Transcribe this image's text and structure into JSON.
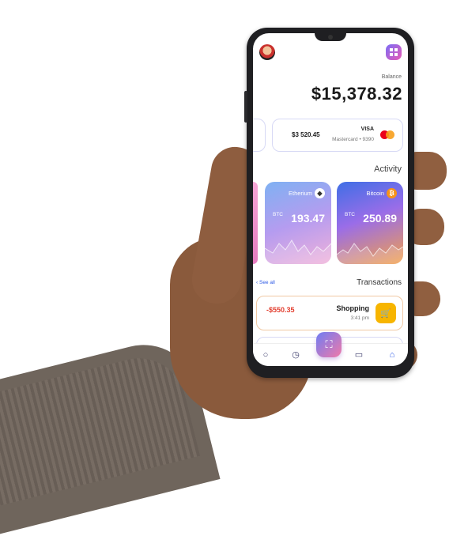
{
  "balance": {
    "label": "Balance",
    "value": "$15,378.32"
  },
  "card": {
    "brand": "VISA",
    "subtitle": "Mastercard • 9390",
    "amount": "$3 520.45",
    "icon": "mastercard-icon"
  },
  "activity": {
    "title": "Activity",
    "tiles": [
      {
        "name": "Bitcoin",
        "value": "250.89",
        "unit": "BTC",
        "icon": "bitcoin-icon"
      },
      {
        "name": "Etherium",
        "value": "193.47",
        "unit": "BTC",
        "icon": "ethereum-icon"
      }
    ]
  },
  "transactions": {
    "title": "Transactions",
    "see_all": "See all",
    "items": [
      {
        "name": "Shopping",
        "time": "3:41 pm",
        "amount": "-$550.35",
        "icon": "shopping-cart-icon"
      }
    ]
  },
  "nav": {
    "icons": [
      "user-icon",
      "clock-icon",
      "scan-icon",
      "card-icon",
      "home-icon"
    ]
  },
  "colors": {
    "accent": "#2f5be6",
    "negative": "#e23d2e",
    "shopping": "#f7b500"
  }
}
